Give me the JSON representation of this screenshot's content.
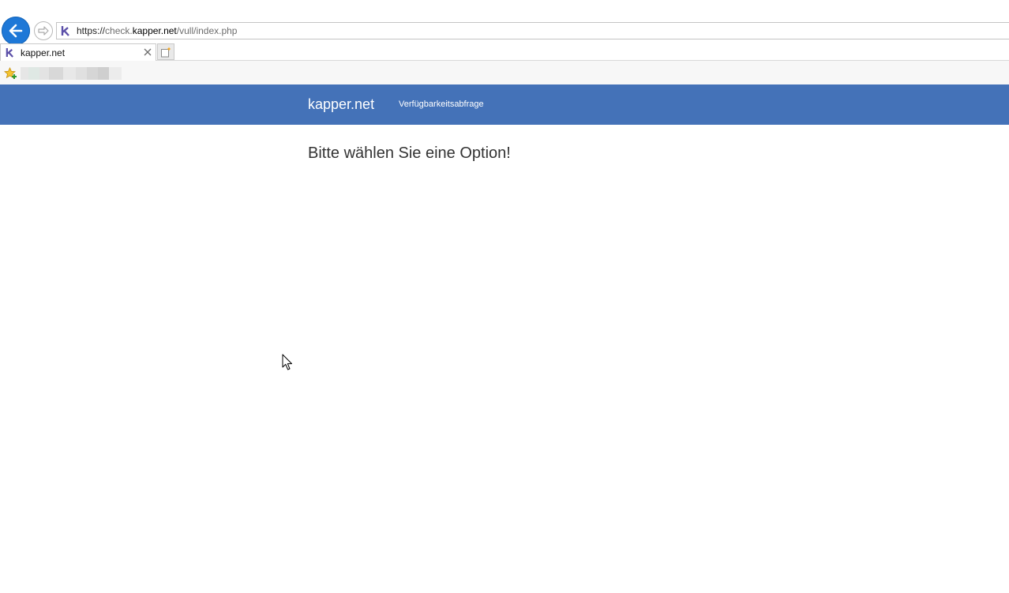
{
  "browser": {
    "url": {
      "scheme": "https://",
      "subdomain": "check.",
      "domain": "kapper.net",
      "path": "/vull/index.php"
    },
    "tab": {
      "title": "kapper.net"
    },
    "icons": {
      "back": "back-arrow-icon",
      "forward": "forward-arrow-icon",
      "favicon": "kapper-k-icon",
      "tab_close": "close-icon",
      "new_tab": "new-tab-icon",
      "favorites": "add-favorite-star-icon"
    },
    "colors": {
      "back_button": "#1e78d7"
    }
  },
  "site": {
    "navbar": {
      "brand": "kapper.net",
      "links": [
        "Verfügbarkeitsabfrage"
      ]
    },
    "heading": "Bitte wählen Sie eine Option!",
    "colors": {
      "navbar_bg": "#4472b8",
      "heading_text": "#333333"
    }
  }
}
